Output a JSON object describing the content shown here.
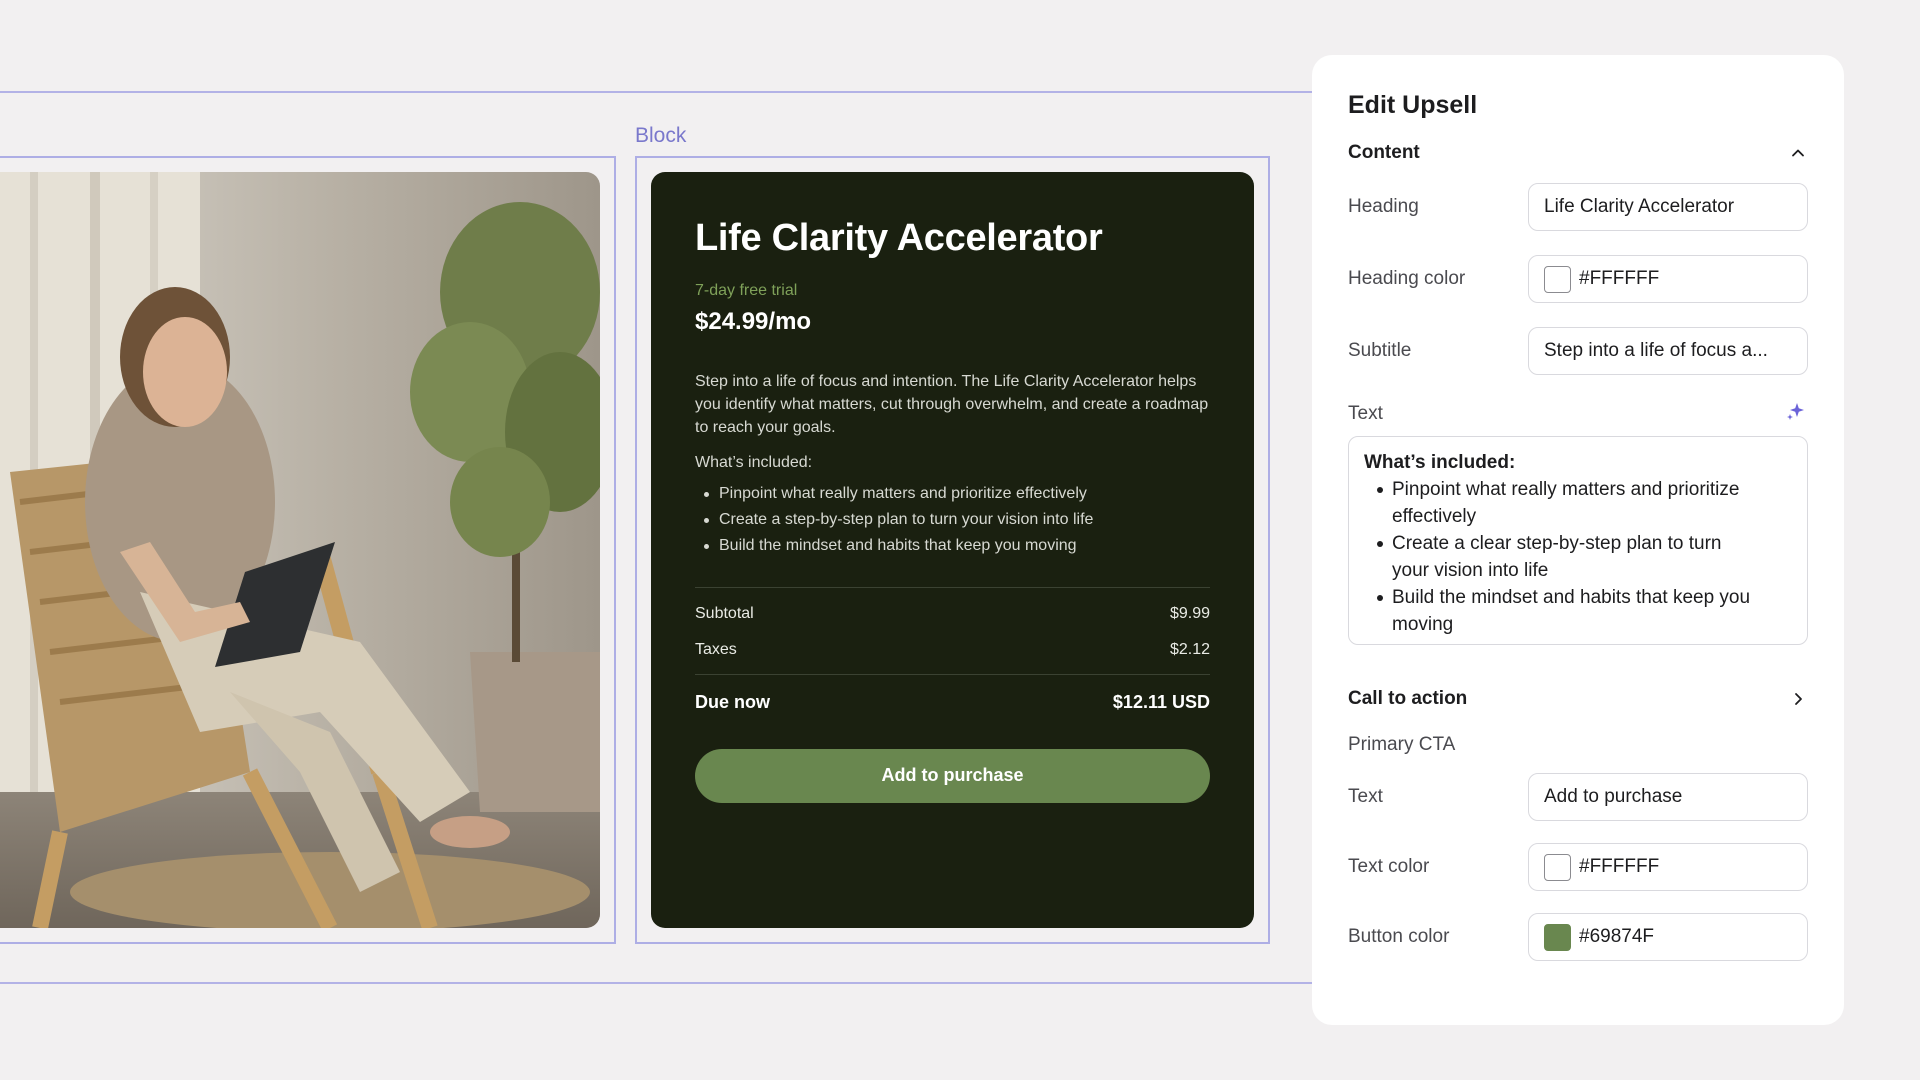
{
  "canvas": {
    "block_label": "Block",
    "photo_alt": "Woman sitting in a wooden chair holding a tablet"
  },
  "upsell_card": {
    "title": "Life Clarity Accelerator",
    "trial": "7-day free trial",
    "price": "$24.99/mo",
    "description": "Step into a life of focus and intention. The Life Clarity Accelerator helps you identify what matters, cut through overwhelm, and create a roadmap to reach your goals.",
    "included_heading": "What’s included:",
    "included_items": [
      "Pinpoint what really matters and prioritize effectively",
      "Create a step-by-step plan to turn your vision into life",
      "Build the mindset and habits that keep you moving"
    ],
    "subtotal_label": "Subtotal",
    "subtotal_value": "$9.99",
    "taxes_label": "Taxes",
    "taxes_value": "$2.12",
    "due_label": "Due now",
    "due_value": "$12.11 USD",
    "cta_label": "Add to purchase",
    "colors": {
      "background": "#1a2010",
      "trial": "#7fa159",
      "button": "#69874f"
    }
  },
  "edit_panel": {
    "title": "Edit Upsell",
    "content_section": {
      "label": "Content",
      "toggle_icon": "chevron-up-icon",
      "heading_label": "Heading",
      "heading_value": "Life Clarity Accelerator",
      "heading_color_label": "Heading color",
      "heading_color_value": "#FFFFFF",
      "subtitle_label": "Subtitle",
      "subtitle_value": "Step into a life of focus a...",
      "text_label": "Text",
      "ai_icon": "sparkle-icon",
      "text_heading": "What’s included:",
      "text_items": [
        "Pinpoint what really matters and prioritize effectively",
        "Create a clear step-by-step plan to turn your vision into life",
        "Build the mindset and habits that keep you moving"
      ]
    },
    "cta_section": {
      "label": "Call to action",
      "toggle_icon": "chevron-right-icon",
      "primary_label": "Primary CTA",
      "text_label": "Text",
      "text_value": "Add to purchase",
      "text_color_label": "Text color",
      "text_color_value": "#FFFFFF",
      "button_color_label": "Button color",
      "button_color_value": "#69874F"
    }
  }
}
